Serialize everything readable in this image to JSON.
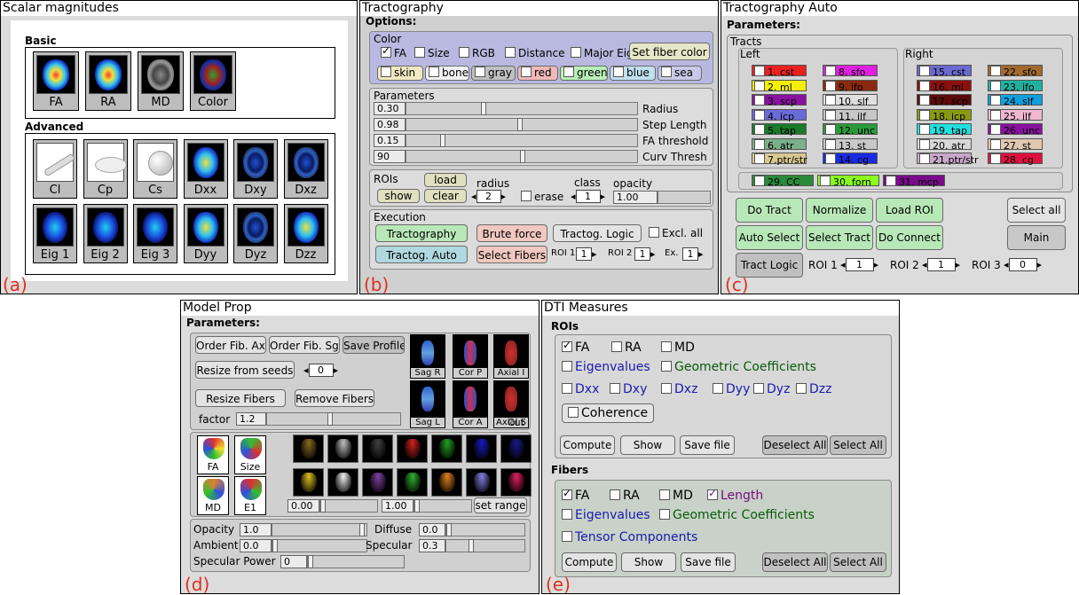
{
  "scalar": {
    "title": "Scalar magnitudes",
    "basic_label": "Basic",
    "advanced_label": "Advanced",
    "basic": [
      "FA",
      "RA",
      "MD",
      "Color"
    ],
    "advanced_row1": [
      "Cl",
      "Cp",
      "Cs",
      "Dxx",
      "Dxy",
      "Dxz"
    ],
    "advanced_row2": [
      "Eig 1",
      "Eig 2",
      "Eig 3",
      "Dyy",
      "Dyz",
      "Dzz"
    ],
    "fig_label": "(a)"
  },
  "tracto": {
    "title": "Tractography",
    "options_label": "Options:",
    "color_label": "Color",
    "color_opts": [
      "FA",
      "Size",
      "RGB",
      "Distance",
      "Major Eig"
    ],
    "set_fiber_color": "Set fiber color",
    "swatches": [
      "skin",
      "bone",
      "gray",
      "red",
      "green",
      "blue",
      "sea"
    ],
    "params_label": "Parameters",
    "params": [
      {
        "value": "0.30",
        "name": "Radius",
        "level": 0.33
      },
      {
        "value": "0.98",
        "name": "Step Length",
        "level": 0.49
      },
      {
        "value": "0.15",
        "name": "FA threshold",
        "level": 0.15
      },
      {
        "value": "90",
        "name": "Curv Thresh",
        "level": 0.5
      }
    ],
    "rois_label": "ROIs",
    "load": "load",
    "show": "show",
    "clear": "clear",
    "radius_label": "radius",
    "radius_value": "2",
    "erase": "erase",
    "class_label": "class",
    "class_value": "1",
    "opacity_label": "opacity",
    "opacity_value": "1.00",
    "exec_label": "Execution",
    "tractography": "Tractography",
    "brute_force": "Brute force",
    "tractog_logic": "Tractog. Logic",
    "excl_all": "Excl. all",
    "tractog_auto": "Tractog. Auto",
    "select_fibers": "Select Fibers",
    "roi1": "ROI 1",
    "roi1_value": "1",
    "roi2": "ROI 2",
    "roi2_value": "1",
    "ex": "Ex.",
    "ex_value": "1",
    "fig_label": "(b)"
  },
  "auto": {
    "title": "Tractography Auto",
    "params_label": "Parameters:",
    "tracts_label": "Tracts",
    "left_label": "Left",
    "right_label": "Right",
    "left_col1": [
      {
        "name": "1. cst",
        "color": "#e82020"
      },
      {
        "name": "2. ml",
        "color": "#f4f000"
      },
      {
        "name": "3. scp",
        "color": "#8a10a0"
      },
      {
        "name": "4. icp",
        "color": "#6a6ad8"
      },
      {
        "name": "5. tap",
        "color": "#1a7a2a"
      },
      {
        "name": "6. atr",
        "color": "#7ab08a"
      },
      {
        "name": "7.ptr/str",
        "color": "#d8c890"
      }
    ],
    "left_col2": [
      {
        "name": "8. sfo",
        "color": "#e020e0"
      },
      {
        "name": "9. ifo",
        "color": "#8a2a10"
      },
      {
        "name": "10. slf",
        "color": "#e0e0e0"
      },
      {
        "name": "11. ilf",
        "color": "#c8c8c8"
      },
      {
        "name": "12. unc",
        "color": "#2a9a3a"
      },
      {
        "name": "13. st",
        "color": "#c8c8c8"
      },
      {
        "name": "14. cg",
        "color": "#1a2ae0"
      }
    ],
    "right_col1": [
      {
        "name": "15. cst",
        "color": "#6a6ad0"
      },
      {
        "name": "16. ml",
        "color": "#8a1010"
      },
      {
        "name": "17. scp",
        "color": "#5a0a0a"
      },
      {
        "name": "18. icp",
        "color": "#8a9a10"
      },
      {
        "name": "19. tap",
        "color": "#20e0e0"
      },
      {
        "name": "20. atr",
        "color": "#d8d8d8"
      },
      {
        "name": "21.ptr/str",
        "color": "#c8a8c8"
      }
    ],
    "right_col2": [
      {
        "name": "22. sfo",
        "color": "#a06a30"
      },
      {
        "name": "23. ifo",
        "color": "#20b0a0"
      },
      {
        "name": "24. slf",
        "color": "#10a0e0"
      },
      {
        "name": "25. ilf",
        "color": "#f0b8d0"
      },
      {
        "name": "26. unc",
        "color": "#8a10a0"
      },
      {
        "name": "27. st",
        "color": "#e0c8b0"
      },
      {
        "name": "28. cg",
        "color": "#e01040"
      }
    ],
    "bottom_tracts": [
      {
        "name": "29. CC",
        "color": "#2a8a3a"
      },
      {
        "name": "30. forn",
        "color": "#8aff20"
      },
      {
        "name": "31. mcp",
        "color": "#7a0a8a"
      }
    ],
    "do_tract": "Do Tract",
    "normalize": "Normalize",
    "load_roi": "Load ROI",
    "select_all": "Select all",
    "auto_select": "Auto Select",
    "select_tract": "Select Tract",
    "do_connect": "Do Connect",
    "main": "Main",
    "tract_logic": "Tract Logic",
    "roi1": "ROI 1",
    "roi1_value": "1",
    "roi2": "ROI 2",
    "roi2_value": "1",
    "roi3": "ROI 3",
    "roi3_value": "0",
    "fig_label": "(c)"
  },
  "model": {
    "title": "Model Prop",
    "params_label": "Parameters:",
    "order_ax": "Order Fib. Ax.",
    "order_sg": "Order Fib. Sg.",
    "save_profile": "Save Profile",
    "resize_seeds": "Resize from seeds",
    "seeds_value": "0",
    "resize_fibers": "Resize Fibers",
    "remove_fibers": "Remove Fibers",
    "factor_label": "factor",
    "factor_value": "1.2",
    "factor_level": 0.47,
    "views": [
      "Sag R",
      "Cor P",
      "Axial I",
      "Sag L",
      "Cor A",
      "Axial S"
    ],
    "cut": "Cut",
    "color_thumbs": [
      "FA",
      "Size",
      "MD",
      "E1"
    ],
    "range_min": "0.00",
    "range_max": "1.00",
    "set_range": "set range",
    "opacity_label": "Opacity",
    "opacity_value": "1.0",
    "opacity_level": 0.98,
    "diffuse_label": "Diffuse",
    "diffuse_value": "0.0",
    "diffuse_level": 0.0,
    "ambient_label": "Ambient",
    "ambient_value": "0.0",
    "ambient_level": 0.0,
    "specular_label": "Specular",
    "specular_value": "0.3",
    "specular_level": 0.3,
    "specpower_label": "Specular Power",
    "specpower_value": "0",
    "specpower_level": 0.0,
    "fig_label": "(d)"
  },
  "dti": {
    "title": "DTI Measures",
    "rois_label": "ROIs",
    "r_fa": "FA",
    "r_ra": "RA",
    "r_md": "MD",
    "r_eigen": "Eigenvalues",
    "r_geo": "Geometric Coefficients",
    "r_dxx": "Dxx",
    "r_dxy": "Dxy",
    "r_dxz": "Dxz",
    "r_dyy": "Dyy",
    "r_dyz": "Dyz",
    "r_dzz": "Dzz",
    "r_coherence": "Coherence",
    "compute": "Compute",
    "show": "Show",
    "save_file": "Save file",
    "deselect_all": "Deselect All",
    "select_all": "Select All",
    "fibers_label": "Fibers",
    "f_fa": "FA",
    "f_ra": "RA",
    "f_md": "MD",
    "f_length": "Length",
    "f_eigen": "Eigenvalues",
    "f_geo": "Geometric Coefficients",
    "f_tensor": "Tensor Components",
    "fig_label": "(e)"
  }
}
